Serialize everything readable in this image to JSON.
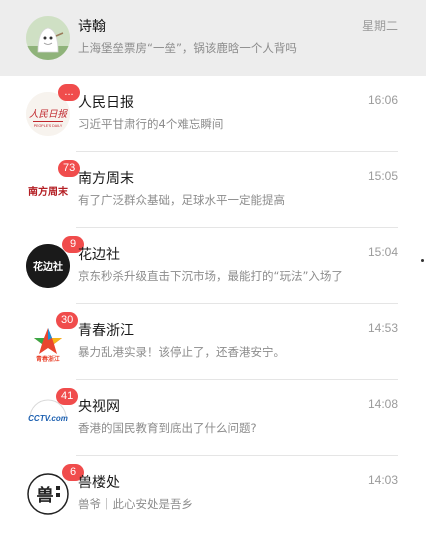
{
  "chats": [
    {
      "name": "诗翰",
      "preview": "上海堡垒票房“一垒”，锅该鹿晗一个人背吗",
      "time": "星期二",
      "badge": "",
      "avatar_icon": "ghost-figure-icon"
    },
    {
      "name": "人民日报",
      "preview": "习近平甘肃行的4个难忘瞬间",
      "time": "16:06",
      "badge": "...",
      "avatar_icon": "people-daily-logo-icon",
      "avatar_text": "人民日报"
    },
    {
      "name": "南方周末",
      "preview": "有了广泛群众基础，足球水平一定能提高",
      "time": "15:05",
      "badge": "73",
      "avatar_icon": "southern-weekly-seal-icon",
      "avatar_text": "南方周末"
    },
    {
      "name": "花边社",
      "preview": "京东秒杀升级直击下沉市场，最能打的“玩法”入场了",
      "time": "15:04",
      "badge": "9",
      "avatar_icon": "huabianshe-logo-icon",
      "avatar_text": "花边社"
    },
    {
      "name": "青春浙江",
      "preview": "暴力乱港实录！该停止了，还香港安宁。",
      "time": "14:53",
      "badge": "30",
      "avatar_icon": "youth-zhejiang-star-icon",
      "avatar_text": "青春浙江"
    },
    {
      "name": "央视网",
      "preview": "香港的国民教育到底出了什么问题?",
      "time": "14:08",
      "badge": "41",
      "avatar_icon": "cctv-logo-icon",
      "avatar_text": "CCTV.com"
    },
    {
      "name": "兽楼处",
      "preview": "兽爷｜此心安处是吾乡",
      "time": "14:03",
      "badge": "6",
      "avatar_icon": "shoulouchu-logo-icon",
      "avatar_text": "兽"
    }
  ],
  "colors": {
    "badge": "#f04c4c",
    "pinned_bg": "#ededed",
    "divider": "#e5e5e5"
  }
}
